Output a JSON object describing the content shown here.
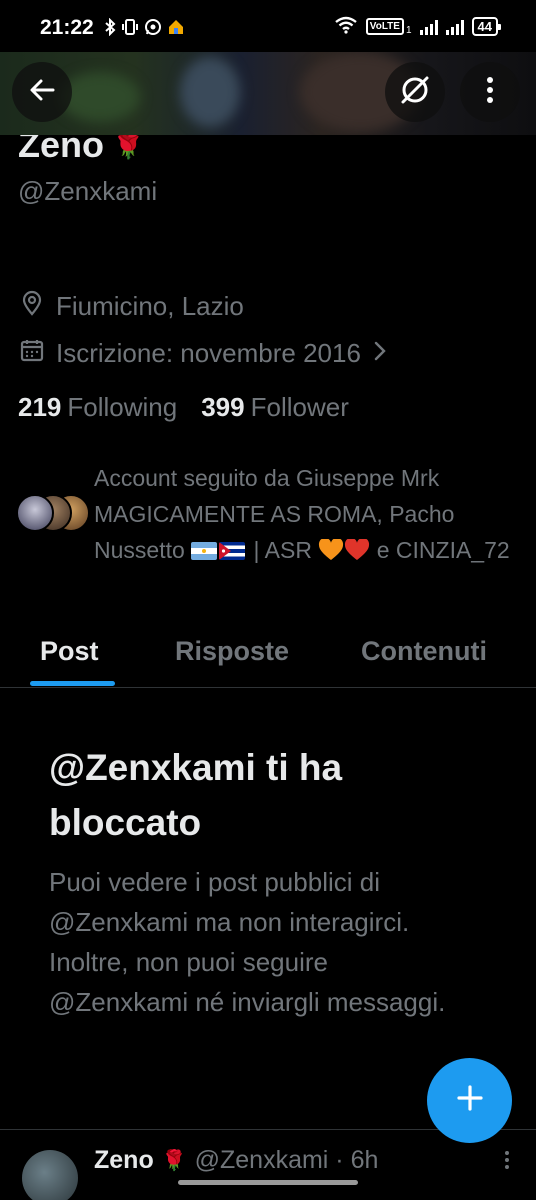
{
  "status_bar": {
    "time": "21:22",
    "volte_label": "VoLTE",
    "sim1": "1",
    "battery": "44"
  },
  "profile": {
    "name": "Zeno",
    "name_emoji": "🌹",
    "handle": "@Zenxkami",
    "location": "Fiumicino, Lazio",
    "joined": "Iscrizione: novembre 2016",
    "following_count": "219",
    "following_label": "Following",
    "followers_count": "399",
    "followers_label": "Follower",
    "followed_by_part1": "Account seguito da Giuseppe Mrk MAGICAMENTE AS ROMA, Pacho Nussetto",
    "followed_by_part2": "| ASR",
    "followed_by_part3": "e",
    "followed_by_part4": "CINZIA_72"
  },
  "tabs": [
    {
      "label": "Post",
      "active": true
    },
    {
      "label": "Risposte",
      "active": false
    },
    {
      "label": "Contenuti",
      "active": false
    }
  ],
  "blocked": {
    "title": "@Zenxkami ti ha bloccato",
    "description": "Puoi vedere i post pubblici di @Zenxkami ma non interagirci. Inoltre, non puoi seguire @Zenxkami né inviargli messaggi."
  },
  "post_preview": {
    "name": "Zeno",
    "name_emoji": "🌹",
    "meta": "@Zenxkami · 6h"
  },
  "colors": {
    "accent": "#1d9bf0",
    "text_primary": "#e7e9ea",
    "text_secondary": "#71767b",
    "background": "#000000"
  },
  "icons": {
    "back": "arrow-left-icon",
    "grok": "grok-icon",
    "more": "more-vertical-icon",
    "location": "location-pin-icon",
    "calendar": "calendar-icon",
    "chevron": "chevron-right-icon",
    "compose": "plus-icon"
  }
}
